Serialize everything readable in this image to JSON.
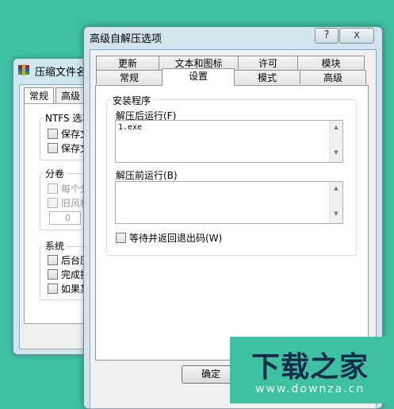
{
  "back_window": {
    "title": "压缩文件名",
    "tabs": [
      "常规",
      "高级"
    ],
    "ntfs_group": {
      "label": "NTFS 选项",
      "items": [
        "保存文",
        "保存文"
      ]
    },
    "volume_group": {
      "label": "分卷",
      "items": [
        "每个分",
        "旧风格"
      ],
      "spinner_value": "0"
    },
    "system_group": {
      "label": "系统",
      "items": [
        "后台压",
        "完成操",
        "如果某"
      ]
    }
  },
  "dialog": {
    "title": "高级自解压选项",
    "help_label": "?",
    "close_label": "X",
    "tabs_row1": [
      "更新",
      "文本和图标",
      "许可",
      "模块"
    ],
    "tabs_row2": [
      "常规",
      "设置",
      "模式",
      "高级"
    ],
    "selected_tab": "设置",
    "setup_group": {
      "label": "安装程序",
      "run_after_label": "解压后运行(F)",
      "run_after_value": "1.exe",
      "run_before_label": "解压前运行(B)",
      "run_before_value": "",
      "wait_checkbox_label": "等待并返回退出码(W)",
      "wait_checked": false
    },
    "ok_label": "确定"
  },
  "watermark": {
    "text": "下载之家",
    "url": "www.downza.cn"
  }
}
